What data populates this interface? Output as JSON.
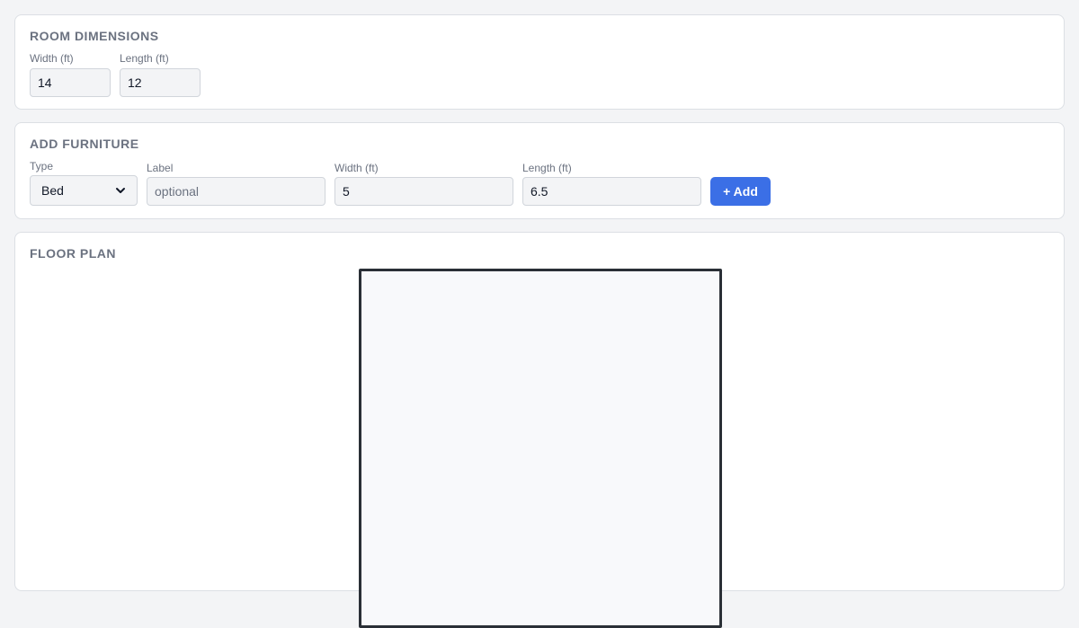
{
  "room": {
    "title": "ROOM DIMENSIONS",
    "width_label": "Width (ft)",
    "width_value": "14",
    "length_label": "Length (ft)",
    "length_value": "12"
  },
  "furniture": {
    "title": "ADD FURNITURE",
    "type_label": "Type",
    "type_value": "Bed",
    "label_label": "Label",
    "label_placeholder": "optional",
    "width_label": "Width (ft)",
    "width_value": "5",
    "length_label": "Length (ft)",
    "length_value": "6.5",
    "add_button": "+ Add"
  },
  "floor_plan": {
    "title": "FLOOR PLAN"
  },
  "colors": {
    "accent": "#3b6fe6",
    "room_border": "#2a2f36",
    "card_background": "#ffffff",
    "page_background": "#f3f4f6"
  }
}
